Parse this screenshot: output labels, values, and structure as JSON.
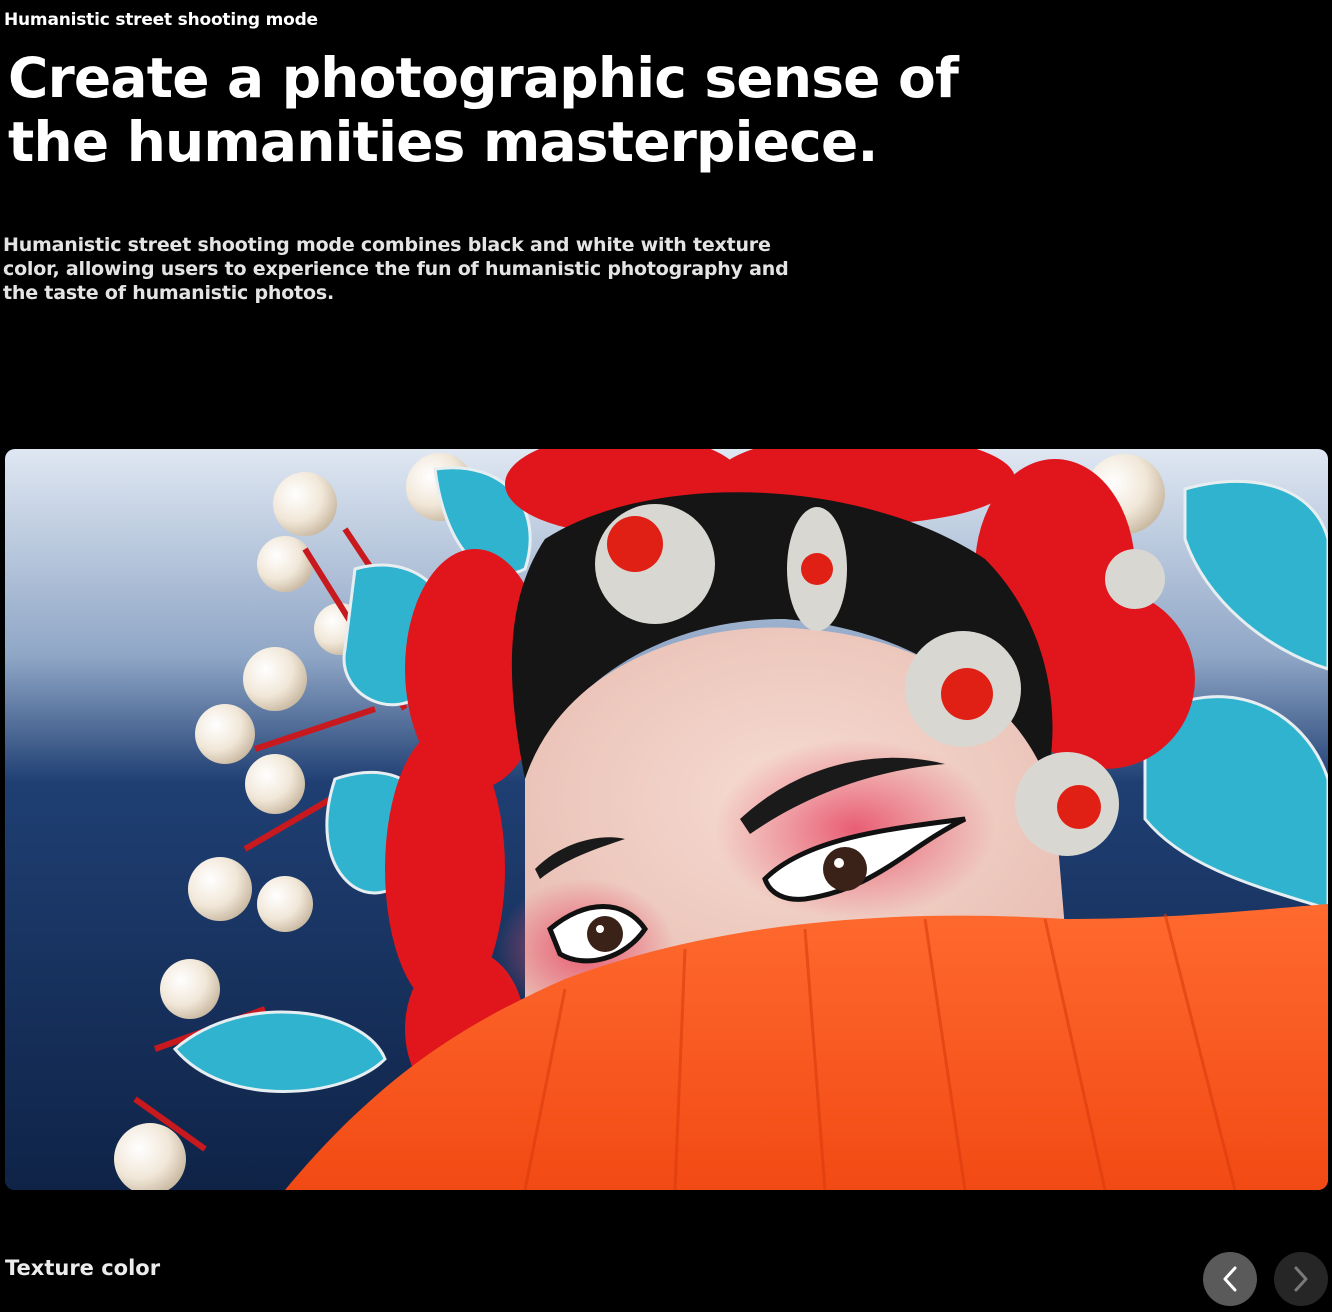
{
  "section": {
    "eyebrow": "Humanistic street shooting mode",
    "headline": "Create a photographic sense of the humanities masterpiece.",
    "description": "Humanistic street shooting mode combines black and white with texture color, allowing users to experience the fun of humanistic photography and the taste of humanistic photos."
  },
  "gallery": {
    "caption": "Texture color",
    "prev_icon": "chevron-left-icon",
    "next_icon": "chevron-right-icon"
  },
  "colors": {
    "background": "#000000",
    "text": "#ffffff",
    "prev_button": "#5a5a5a",
    "next_button": "#262626"
  }
}
